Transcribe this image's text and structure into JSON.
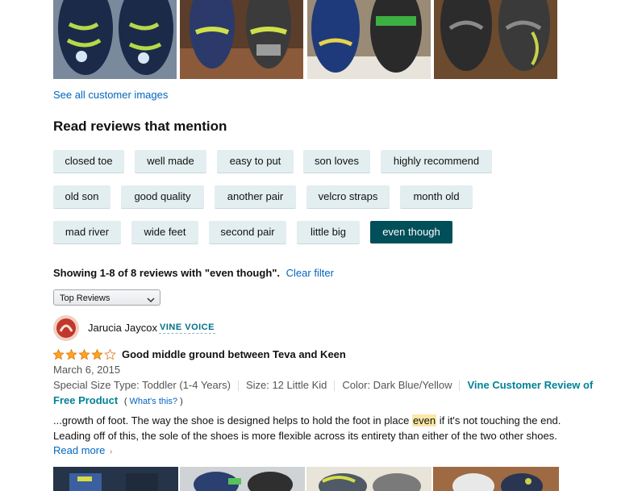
{
  "links": {
    "see_all_images": "See all customer images"
  },
  "mentions": {
    "heading": "Read reviews that mention",
    "phrases": [
      "closed toe",
      "well made",
      "easy to put",
      "son loves",
      "highly recommend",
      "old son",
      "good quality",
      "another pair",
      "velcro straps",
      "month old",
      "mad river",
      "wide feet",
      "second pair",
      "little big",
      "even though"
    ],
    "active_phrase": "even though"
  },
  "filter": {
    "showing_text": "Showing 1-8 of 8 reviews with \"even though\".",
    "clear_label": "Clear filter"
  },
  "sort": {
    "selected": "Top Reviews"
  },
  "review": {
    "reviewer_name": "Jarucia Jaycox",
    "badge": "VINE VOICE",
    "rating": 4,
    "title": "Good middle ground between Teva and Keen",
    "date": "March 6, 2015",
    "size_type": "Special Size Type: Toddler (1-4 Years)",
    "size": "Size: 12 Little Kid",
    "color": "Color: Dark Blue/Yellow",
    "vine_label_1": "Vine Customer Review of",
    "vine_label_2": "Free Product",
    "whats_this_open": "(",
    "whats_this": "What's this?",
    "whats_this_close": ")",
    "body_before": "...growth of foot. The way the shoe is designed helps to hold the foot in place ",
    "body_highlight": "even",
    "body_after": " if it's not touching the end.",
    "body_line2": "Leading off of this, the sole of the shoes is more flexible across its entirety than either of the two other shoes.",
    "read_more": "Read more"
  },
  "colors": {
    "link": "#0066c0",
    "active_chip": "#004f59",
    "chip": "#e3eef0",
    "star": "#ffa41c",
    "highlight": "#fbe8a6"
  },
  "icons": {
    "stars": "star-icon",
    "dropdown": "chevron-down-icon",
    "read_more": "chevron-right-icon"
  }
}
